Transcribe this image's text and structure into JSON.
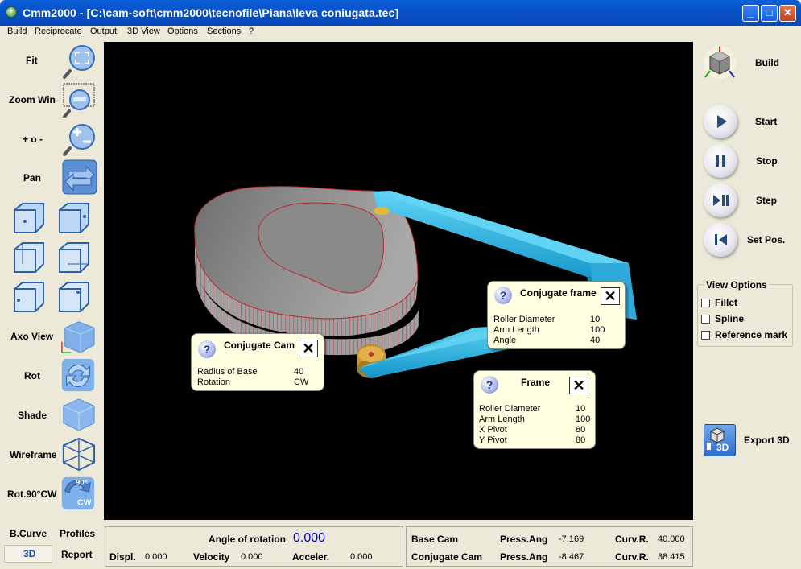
{
  "window": {
    "title": "Cmm2000 - [C:\\cam-soft\\cmm2000\\tecnofile\\Piana\\leva coniugata.tec]",
    "minimize": "_",
    "maximize": "□",
    "close": "✕"
  },
  "menu": [
    "Build",
    "Reciprocate",
    "Output",
    "3D View",
    "Options",
    "Sections",
    "?"
  ],
  "left_toolbar": {
    "fit": "Fit",
    "zoom_win": "Zoom Win",
    "zoom_plus_minus": "+ o -",
    "pan": "Pan",
    "axo_view": "Axo View",
    "rot": "Rot",
    "shade": "Shade",
    "wireframe": "Wireframe",
    "rot90": "Rot.90°CW",
    "rot90_icon_text": "90°",
    "rot90_icon_cw": "CW"
  },
  "bottom_left": {
    "b_curve": "B.Curve",
    "profiles": "Profiles",
    "three_d": "3D",
    "report": "Report"
  },
  "info_boxes": {
    "conjugate_cam": {
      "title": "Conjugate Cam",
      "rows": [
        {
          "label": "Radius of Base",
          "value": "40"
        },
        {
          "label": "Rotation",
          "value": "CW"
        }
      ]
    },
    "conjugate_frame": {
      "title": "Conjugate frame",
      "rows": [
        {
          "label": "Roller Diameter",
          "value": "10"
        },
        {
          "label": "Arm Length",
          "value": "100"
        },
        {
          "label": "Angle",
          "value": "40"
        }
      ]
    },
    "frame": {
      "title": "Frame",
      "rows": [
        {
          "label": "Roller Diameter",
          "value": "10"
        },
        {
          "label": "Arm Length",
          "value": "100"
        },
        {
          "label": "X Pivot",
          "value": "80"
        },
        {
          "label": "Y Pivot",
          "value": "80"
        }
      ]
    },
    "question_mark": "?",
    "close_mark": "✕"
  },
  "right_panel": {
    "build": "Build",
    "start": "Start",
    "stop": "Stop",
    "step": "Step",
    "set_pos": "Set Pos.",
    "view_options": {
      "legend": "View Options",
      "fillet": "Fillet",
      "spline": "Spline",
      "reference_mark": "Reference mark"
    },
    "export_3d": "Export 3D",
    "export_icon_text": "3D"
  },
  "bottom_status": {
    "angle_of_rotation_label": "Angle of rotation",
    "angle_of_rotation_value": "0.000",
    "displ_label": "Displ.",
    "displ_value": "0.000",
    "velocity_label": "Velocity",
    "velocity_value": "0.000",
    "acceler_label": "Acceler.",
    "acceler_value": "0.000",
    "base_cam_label": "Base Cam",
    "base_cam_press_ang_label": "Press.Ang",
    "base_cam_press_ang_value": "-7.169",
    "base_cam_curv_r_label": "Curv.R.",
    "base_cam_curv_r_value": "40.000",
    "conjugate_cam_label": "Conjugate Cam",
    "conjugate_cam_press_ang_label": "Press.Ang",
    "conjugate_cam_press_ang_value": "-8.467",
    "conjugate_cam_curv_r_label": "Curv.R.",
    "conjugate_cam_curv_r_value": "38.415"
  },
  "colors": {
    "titlebar": "#0853C9",
    "viewport_bg": "#000000",
    "cam_body": "#8A8A8A",
    "cam_edge": "#C0242A",
    "follower_arm": "#29B6E6",
    "roller": "#C9962E",
    "angle_value": "#0000CC",
    "tooltip_bg": "#FFFFE1"
  }
}
